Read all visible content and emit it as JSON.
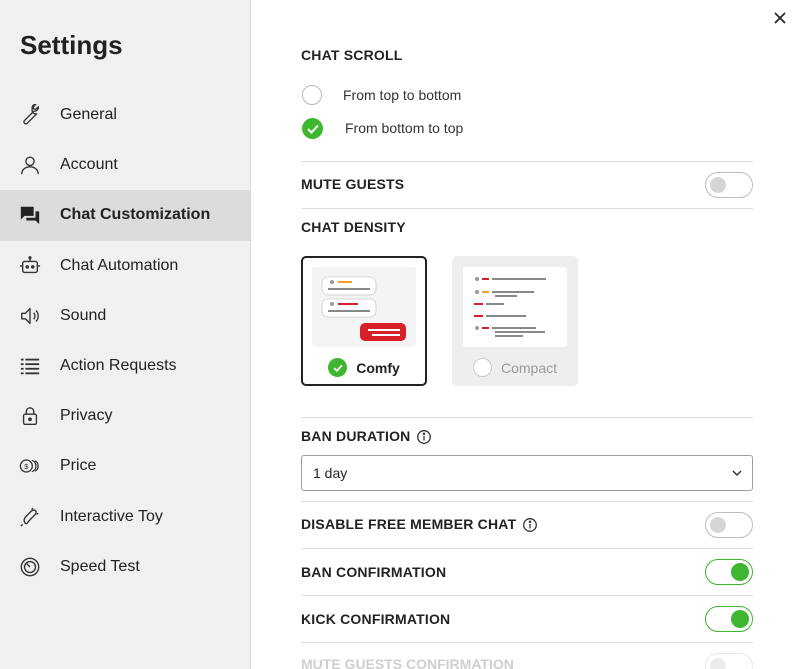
{
  "sidebar": {
    "title": "Settings",
    "items": [
      {
        "label": "General",
        "icon": "wrench-icon"
      },
      {
        "label": "Account",
        "icon": "user-icon"
      },
      {
        "label": "Chat Customization",
        "icon": "chat-bubbles-icon",
        "active": true
      },
      {
        "label": "Chat Automation",
        "icon": "robot-icon"
      },
      {
        "label": "Sound",
        "icon": "speaker-icon"
      },
      {
        "label": "Action Requests",
        "icon": "list-icon"
      },
      {
        "label": "Privacy",
        "icon": "lock-icon"
      },
      {
        "label": "Price",
        "icon": "coins-icon"
      },
      {
        "label": "Interactive Toy",
        "icon": "toy-icon"
      },
      {
        "label": "Speed Test",
        "icon": "speedometer-icon"
      }
    ]
  },
  "close_icon": "close-icon",
  "chat_scroll": {
    "title": "CHAT SCROLL",
    "options": [
      {
        "label": "From top to bottom",
        "selected": false
      },
      {
        "label": "From bottom to top",
        "selected": true
      }
    ]
  },
  "mute_guests": {
    "label": "MUTE GUESTS",
    "on": false
  },
  "chat_density": {
    "title": "CHAT DENSITY",
    "options": [
      {
        "label": "Comfy",
        "selected": true
      },
      {
        "label": "Compact",
        "selected": false
      }
    ]
  },
  "ban_duration": {
    "label": "BAN DURATION",
    "value": "1 day"
  },
  "disable_free_member_chat": {
    "label": "DISABLE FREE MEMBER CHAT",
    "on": false
  },
  "ban_confirmation": {
    "label": "BAN CONFIRMATION",
    "on": true
  },
  "kick_confirmation": {
    "label": "KICK CONFIRMATION",
    "on": true
  },
  "mute_guests_confirmation": {
    "label": "MUTE GUESTS CONFIRMATION"
  },
  "colors": {
    "accent_green": "#3fb62f",
    "brand_red": "#d8202a",
    "orange": "#f0a028"
  }
}
